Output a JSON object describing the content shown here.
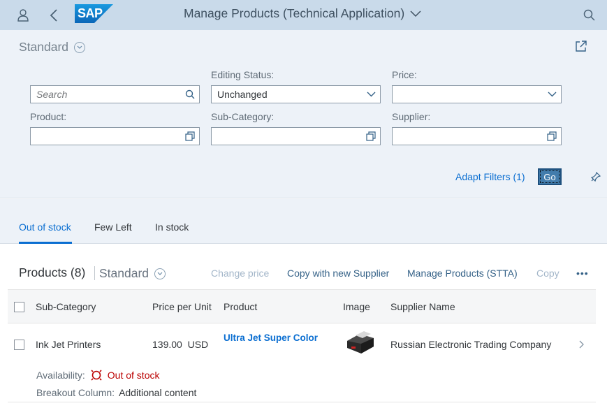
{
  "shell": {
    "title": "Manage Products (Technical Application)",
    "logo_text": "SAP",
    "icons": [
      "user-icon",
      "back-icon",
      "chevron-down-icon",
      "search-icon"
    ]
  },
  "filterbar": {
    "variant": "Standard",
    "search_placeholder": "Search",
    "editing_status_label": "Editing Status:",
    "editing_status_value": "Unchanged",
    "price_label": "Price:",
    "price_value": "",
    "product_label": "Product:",
    "subcategory_label": "Sub-Category:",
    "supplier_label": "Supplier:",
    "adapt_filters": "Adapt Filters (1)",
    "go": "Go"
  },
  "tabs": [
    "Out of stock",
    "Few Left",
    "In stock"
  ],
  "selected_tab": "Out of stock",
  "table": {
    "title": "Products (8)",
    "variant": "Standard",
    "toolbar": {
      "change_price": "Change price",
      "copy_with_new_supplier": "Copy with new Supplier",
      "manage_products_stta": "Manage Products (STTA)",
      "copy": "Copy",
      "more": "•••"
    },
    "columns": [
      "Sub-Category",
      "Price per Unit",
      "Product",
      "Image",
      "Supplier Name"
    ],
    "rows": [
      {
        "sub_category": "Ink Jet Printers",
        "price": "139.00",
        "currency": "USD",
        "product": "Ultra Jet Super Color",
        "supplier": "Russian Electronic Trading Company",
        "availability_label": "Availability:",
        "availability": "Out of stock",
        "breakout_label": "Breakout Column:",
        "breakout_value": "Additional content"
      }
    ]
  },
  "colors": {
    "shell_bg": "#c9daea",
    "filterbar_bg": "#edf2f8",
    "link": "#0a6ed1",
    "error": "#bb0000"
  }
}
